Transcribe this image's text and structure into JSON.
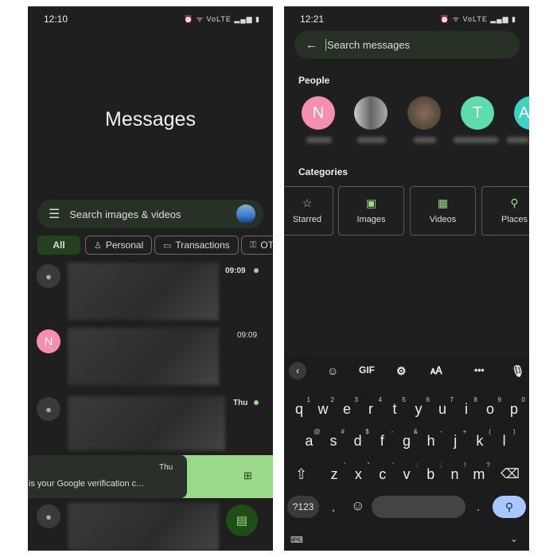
{
  "left": {
    "status_time": "12:10",
    "status_icons": "⏰ ᯤ VoLTE ▂▄▆ ▮",
    "title": "Messages",
    "search_placeholder": "Search images & videos",
    "chips": [
      {
        "label": "All",
        "icon": ""
      },
      {
        "label": "Personal",
        "icon": "person-icon"
      },
      {
        "label": "Transactions",
        "icon": "card-icon"
      },
      {
        "label": "OTP",
        "icon": "key-icon"
      }
    ],
    "conversations": [
      {
        "time": "09:09",
        "unread": true,
        "avatar": ""
      },
      {
        "time": "09:09",
        "unread": false,
        "avatar": "N"
      },
      {
        "time": "Thu",
        "unread": true,
        "avatar": ""
      },
      {
        "time": "Thu",
        "snippet": "is your Google verification c...",
        "swiped": true
      },
      {
        "time": "",
        "avatar": ""
      }
    ],
    "colors": {
      "accent": "#9bd98a",
      "fab": "#1f4d17",
      "avatar_n": "#f48fb1"
    }
  },
  "right": {
    "status_time": "12:21",
    "status_icons": "⏰ ᯤ VoLTE ▂▄▆ ▮",
    "search_placeholder": "Search messages",
    "people_heading": "People",
    "people": [
      {
        "initial": "N",
        "color": "#f48fb1"
      },
      {
        "initial": "",
        "color": "#777777"
      },
      {
        "initial": "",
        "color": "#5a4a40"
      },
      {
        "initial": "T",
        "color": "#5fdcae"
      },
      {
        "initial": "A",
        "color": "#3fd2c0"
      }
    ],
    "categories_heading": "Categories",
    "categories": [
      {
        "label": "Starred",
        "icon": "star-icon"
      },
      {
        "label": "Images",
        "icon": "image-icon"
      },
      {
        "label": "Videos",
        "icon": "video-icon"
      },
      {
        "label": "Places",
        "icon": "place-icon"
      }
    ],
    "keyboard": {
      "toolbar": {
        "gif": "GIF"
      },
      "row1": [
        [
          "q",
          "1"
        ],
        [
          "w",
          "2"
        ],
        [
          "e",
          "3"
        ],
        [
          "r",
          "4"
        ],
        [
          "t",
          "5"
        ],
        [
          "y",
          "6"
        ],
        [
          "u",
          "7"
        ],
        [
          "i",
          "8"
        ],
        [
          "o",
          "9"
        ],
        [
          "p",
          "0"
        ]
      ],
      "row2": [
        [
          "a",
          "@"
        ],
        [
          "s",
          "#"
        ],
        [
          "d",
          "$"
        ],
        [
          "f",
          "-"
        ],
        [
          "g",
          "&"
        ],
        [
          "h",
          "-"
        ],
        [
          "j",
          "+"
        ],
        [
          "k",
          "("
        ],
        [
          "l",
          ")"
        ]
      ],
      "row3": [
        [
          "z",
          "'"
        ],
        [
          "x",
          "\""
        ],
        [
          "c",
          "'"
        ],
        [
          "v",
          ":"
        ],
        [
          "b",
          ";"
        ],
        [
          "n",
          "!"
        ],
        [
          "m",
          "?"
        ]
      ],
      "symbols_key": "?123",
      "comma": ",",
      "period": "."
    }
  }
}
